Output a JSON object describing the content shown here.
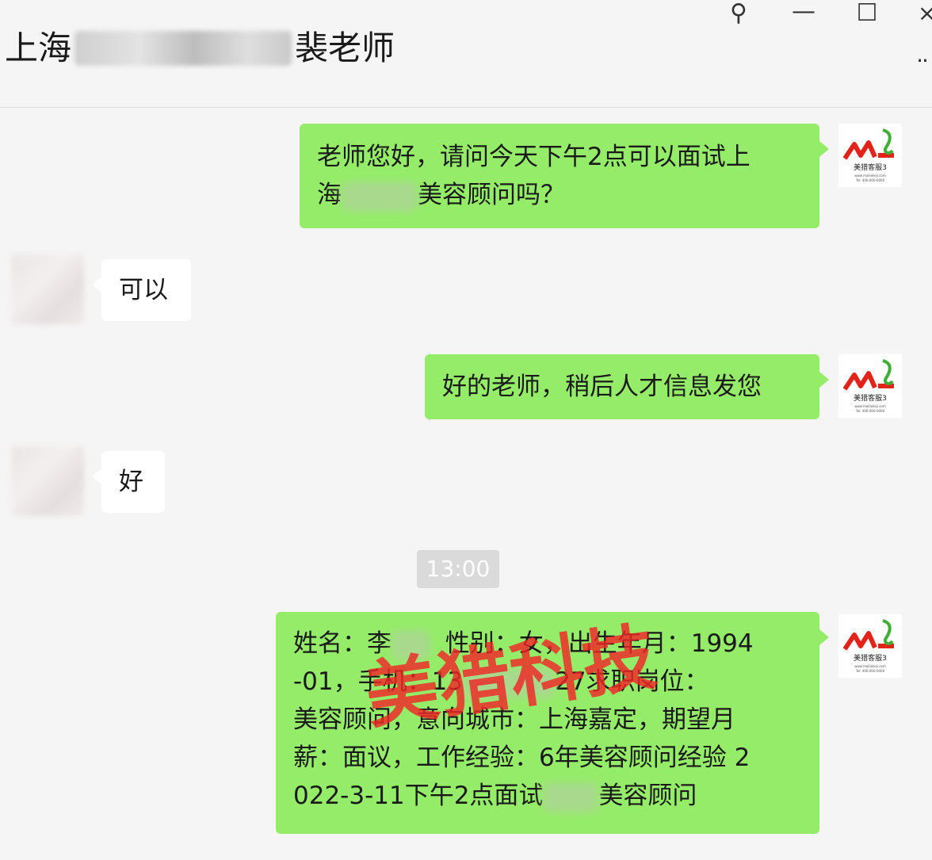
{
  "window": {
    "title_prefix": "上海",
    "title_suffix": "裴老师",
    "controls": {
      "pin": "⚲",
      "minimize": "—",
      "maximize": "☐",
      "close": "×",
      "more": "··"
    }
  },
  "messages": [
    {
      "direction": "out",
      "lines": [
        "老师您好，请问今天下午2点可以面试上",
        "海",
        "美容顾问吗？"
      ]
    },
    {
      "direction": "in",
      "text": "可以"
    },
    {
      "direction": "out",
      "text": "好的老师，稍后人才信息发您"
    },
    {
      "direction": "in",
      "text": "好"
    },
    {
      "direction": "out",
      "lines": [
        "姓名：李",
        "性别：女，出生年月：1994",
        "-01，手机：13",
        "27",
        "求职岗位：",
        "美容顾问，意向城市：上海嘉定，期望月",
        "薪：面议，工作经验：6年美容顾问经验 2",
        "022-3-11下午2点面试",
        "美容顾问"
      ]
    }
  ],
  "timestamp": "13:00",
  "watermark": "美猎科技",
  "avatar_logo": {
    "mark": "ML",
    "name": "美猎客服3",
    "line1": "www.meiliekeji.com",
    "line2": "Tel: 400-000-0000"
  },
  "colors": {
    "bubble_out": "#95ec69",
    "bubble_in": "#ffffff",
    "background": "#f5f5f5",
    "watermark": "#f02626"
  }
}
